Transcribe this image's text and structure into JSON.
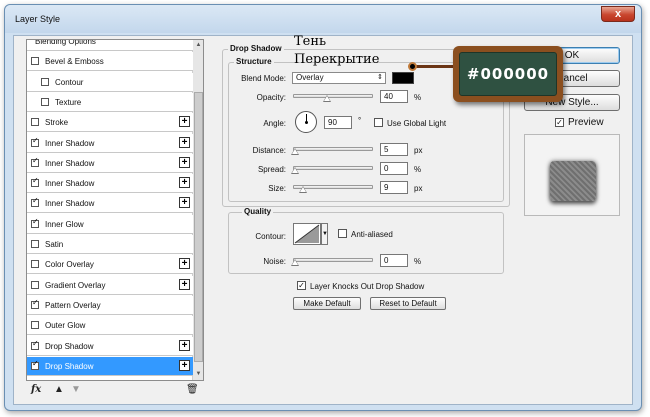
{
  "window": {
    "title": "Layer Style",
    "close_glyph": "x"
  },
  "style_list": {
    "items": [
      {
        "label": "Blending Options",
        "has_checkbox": false,
        "checked": false,
        "has_plus": false,
        "indent": false,
        "active": false
      },
      {
        "label": "Bevel & Emboss",
        "has_checkbox": true,
        "checked": false,
        "has_plus": false,
        "indent": false,
        "active": false
      },
      {
        "label": "Contour",
        "has_checkbox": true,
        "checked": false,
        "has_plus": false,
        "indent": true,
        "active": false
      },
      {
        "label": "Texture",
        "has_checkbox": true,
        "checked": false,
        "has_plus": false,
        "indent": true,
        "active": false
      },
      {
        "label": "Stroke",
        "has_checkbox": true,
        "checked": false,
        "has_plus": true,
        "indent": false,
        "active": false
      },
      {
        "label": "Inner Shadow",
        "has_checkbox": true,
        "checked": true,
        "has_plus": true,
        "indent": false,
        "active": false
      },
      {
        "label": "Inner Shadow",
        "has_checkbox": true,
        "checked": true,
        "has_plus": true,
        "indent": false,
        "active": false
      },
      {
        "label": "Inner Shadow",
        "has_checkbox": true,
        "checked": true,
        "has_plus": true,
        "indent": false,
        "active": false
      },
      {
        "label": "Inner Shadow",
        "has_checkbox": true,
        "checked": true,
        "has_plus": true,
        "indent": false,
        "active": false
      },
      {
        "label": "Inner Glow",
        "has_checkbox": true,
        "checked": true,
        "has_plus": false,
        "indent": false,
        "active": false
      },
      {
        "label": "Satin",
        "has_checkbox": true,
        "checked": false,
        "has_plus": false,
        "indent": false,
        "active": false
      },
      {
        "label": "Color Overlay",
        "has_checkbox": true,
        "checked": false,
        "has_plus": true,
        "indent": false,
        "active": false
      },
      {
        "label": "Gradient Overlay",
        "has_checkbox": true,
        "checked": false,
        "has_plus": true,
        "indent": false,
        "active": false
      },
      {
        "label": "Pattern Overlay",
        "has_checkbox": true,
        "checked": true,
        "has_plus": false,
        "indent": false,
        "active": false
      },
      {
        "label": "Outer Glow",
        "has_checkbox": true,
        "checked": false,
        "has_plus": false,
        "indent": false,
        "active": false
      },
      {
        "label": "Drop Shadow",
        "has_checkbox": true,
        "checked": true,
        "has_plus": true,
        "indent": false,
        "active": false
      },
      {
        "label": "Drop Shadow",
        "has_checkbox": true,
        "checked": true,
        "has_plus": true,
        "indent": false,
        "active": true
      }
    ],
    "footer": {
      "fx": "fx",
      "up": "▲",
      "down": "▼",
      "trash": "🗑"
    }
  },
  "drop_shadow": {
    "title": "Drop Shadow",
    "structure_title": "Structure",
    "blend_mode_label": "Blend Mode:",
    "blend_mode_value": "Overlay",
    "shadow_color": "#000000",
    "opacity_label": "Opacity:",
    "opacity_value": "40",
    "opacity_unit": "%",
    "angle_label": "Angle:",
    "angle_value": "90",
    "angle_unit": "°",
    "global_light_label": "Use Global Light",
    "global_light_checked": false,
    "distance_label": "Distance:",
    "distance_value": "5",
    "distance_unit": "px",
    "spread_label": "Spread:",
    "spread_value": "0",
    "spread_unit": "%",
    "size_label": "Size:",
    "size_value": "9",
    "size_unit": "px"
  },
  "quality": {
    "title": "Quality",
    "contour_label": "Contour:",
    "anti_aliased_label": "Anti-aliased",
    "anti_aliased_checked": false,
    "noise_label": "Noise:",
    "noise_value": "0",
    "noise_unit": "%"
  },
  "knocks_out": {
    "label": "Layer Knocks Out Drop Shadow",
    "checked": true
  },
  "buttons": {
    "make_default": "Make Default",
    "reset_default": "Reset to Default",
    "ok": "OK",
    "cancel": "Cancel",
    "new_style": "New Style...",
    "preview_label": "Preview",
    "preview_checked": true
  },
  "annotations": {
    "line1": "Тень",
    "line2": "Перекрытие",
    "badge_text": "#000000"
  }
}
